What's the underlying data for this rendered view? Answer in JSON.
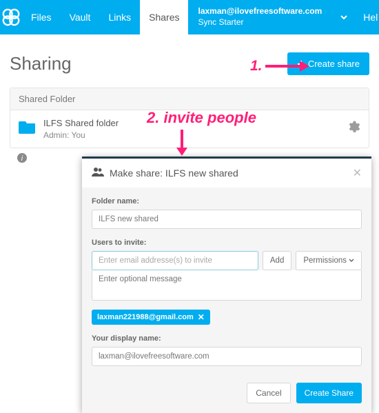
{
  "nav": {
    "items": [
      "Files",
      "Vault",
      "Links",
      "Shares"
    ],
    "active_index": 3,
    "email": "laxman@ilovefreesoftware.com",
    "plan": "Sync Starter",
    "help": "Hel"
  },
  "page": {
    "title": "Sharing",
    "create_btn": "Create share"
  },
  "panel": {
    "header": "Shared Folder",
    "folder_name": "ILFS Shared folder",
    "admin_line": "Admin: You"
  },
  "modal": {
    "title": "Make share: ILFS new shared",
    "folder_label": "Folder name:",
    "folder_value": "ILFS new shared",
    "users_label": "Users to invite:",
    "email_placeholder": "Enter email addresse(s) to invite",
    "add_btn": "Add",
    "perm_btn": "Permissions",
    "msg_placeholder": "Enter optional message",
    "tag_email": "laxman221988@gmail.com",
    "display_label": "Your display name:",
    "display_value": "laxman@ilovefreesoftware.com",
    "cancel": "Cancel",
    "submit": "Create Share"
  },
  "annotation": {
    "step1": "1.",
    "step2": "2. invite people"
  }
}
